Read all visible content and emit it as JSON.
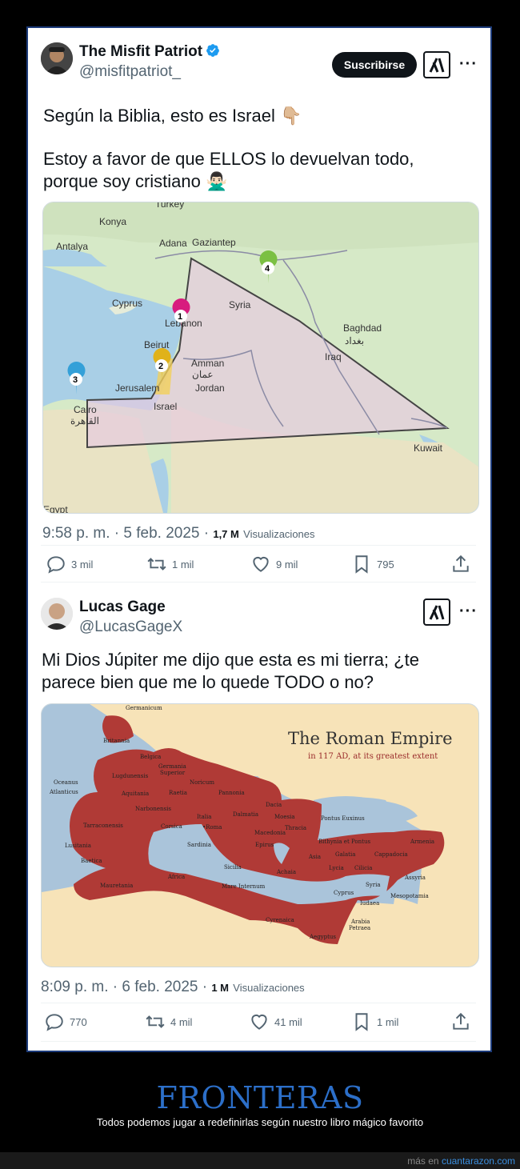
{
  "tweets": [
    {
      "name": "The Misfit Patriot",
      "handle": "@misfitpatriot_",
      "verified": true,
      "subscribe_label": "Suscribirse",
      "text_line1": "Según la Biblia, esto es Israel 👇🏼",
      "text_line2": "Estoy a favor de que ELLOS lo devuelvan todo,",
      "text_line3": "porque soy cristiano 🙅🏻‍♂️",
      "time": "9:58 p. m. · 5 feb. 2025 · ",
      "views_count": "1,7 M",
      "views_label": "Visualizaciones",
      "replies": "3 mil",
      "reposts": "1 mil",
      "likes": "9 mil",
      "bookmarks": "795",
      "map_labels": {
        "turkey": "Turkey",
        "konya": "Konya",
        "antalya": "Antalya",
        "adana": "Adana",
        "gaziantep": "Gaziantep",
        "cyprus": "Cyprus",
        "syria": "Syria",
        "lebanon": "Lebanon",
        "beirut": "Beirut",
        "baghdad": "Baghdad",
        "baghdad_ar": "بغداد",
        "amman": "Amman",
        "amman_ar": "عمان",
        "jordan": "Jordan",
        "iraq": "Iraq",
        "jerusalem": "Jerusalem",
        "israel": "Israel",
        "cairo": "Cairo",
        "cairo_ar": "القاهرة",
        "kuwait": "Kuwait",
        "egypt": "Egypt",
        "pin1": "1",
        "pin2": "2",
        "pin3": "3",
        "pin4": "4"
      }
    },
    {
      "name": "Lucas Gage",
      "handle": "@LucasGageX",
      "text_line1": "Mi Dios Júpiter me dijo que esta es mi tierra; ¿te",
      "text_line2": "parece bien que me lo quede TODO o no?",
      "time": "8:09 p. m. · 6 feb. 2025 · ",
      "views_count": "1 M",
      "views_label": "Visualizaciones",
      "replies": "770",
      "reposts": "4 mil",
      "likes": "41 mil",
      "bookmarks": "1 mil",
      "map_title": "The Roman Empire",
      "map_subtitle": "in 117 AD, at its greatest extent",
      "map_labels": {
        "germanicum": "Germanicum",
        "britannia": "Britannia",
        "belgica": "Belgica",
        "germania": "Germania",
        "superior": "Superior",
        "lugdunensis": "Lugdunensis",
        "noricum": "Noricum",
        "oceanus": "Oceanus",
        "atlanticus": "Atlanticus",
        "aquitania": "Aquitania",
        "raetia": "Raetia",
        "pannonia": "Pannonia",
        "narbonensis": "Narbonensis",
        "dacia": "Dacia",
        "tarraconensis": "Tarraconensis",
        "corsica": "Corsica",
        "italia": "Italia",
        "dalmatia": "Dalmatia",
        "moesia": "Moesia",
        "pontus_euxinus": "Pontus Euxinus",
        "roma": "•Roma",
        "thracia": "Thracia",
        "macedonia": "Macedonia",
        "lusitania": "Lusitania",
        "sardinia": "Sardinia",
        "epirus": "Epirus",
        "bithynia": "Bithynia et Pontus",
        "armenia": "Armenia",
        "baetica": "Baetica",
        "asia": "Asia",
        "galatia": "Galatia",
        "cappadocia": "Cappadocia",
        "sicilia": "Sicilia",
        "achaia": "Achaia",
        "lycia": "Lycia",
        "cilicia": "Cilicia",
        "assyria": "Assyria",
        "africa": "Africa",
        "mauretania": "Mauretania",
        "mare_internum": "Mare Internum",
        "cyprus": "Cyprus",
        "syria": "Syria",
        "mesopotamia": "Mesopotamia",
        "iudaea": "Iudaea",
        "cyrenaica": "Cyrenaica",
        "arabia": "Arabia",
        "petraea": "Petraea",
        "aegyptus": "Aegyptus"
      }
    }
  ],
  "footer": {
    "title": "FRONTERAS",
    "subtitle": "Todos podemos jugar a redefinirlas según nuestro libro mágico favorito",
    "site_prefix": "más en ",
    "site_link": "cuantarazon.com"
  },
  "colors": {
    "accent": "#1d9bf0",
    "title": "#2c6fc9",
    "empire": "#b03a36",
    "sea": "#aac4da",
    "land": "#f7e3b8"
  }
}
